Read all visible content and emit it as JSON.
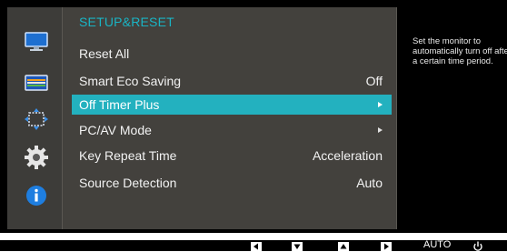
{
  "menu": {
    "title": "SETUP&RESET",
    "items": [
      {
        "label": "Reset All",
        "value": "",
        "arrow": false,
        "selected": false
      },
      {
        "label": "Smart Eco Saving",
        "value": "Off",
        "arrow": false,
        "selected": false
      },
      {
        "label": "Off Timer Plus",
        "value": "",
        "arrow": true,
        "selected": true
      },
      {
        "label": "PC/AV Mode",
        "value": "",
        "arrow": true,
        "selected": false
      },
      {
        "label": "Key Repeat Time",
        "value": "Acceleration",
        "arrow": false,
        "selected": false
      },
      {
        "label": "Source Detection",
        "value": "Auto",
        "arrow": false,
        "selected": false
      }
    ]
  },
  "help": {
    "text": "Set the monitor to automatically turn off after a certain time period."
  },
  "sidebar": {
    "icons": [
      "picture-icon",
      "color-icon",
      "size-position-icon",
      "setup-reset-gear-icon",
      "information-icon"
    ]
  },
  "bottom_bar": {
    "auto_label": "AUTO",
    "buttons": [
      "left-arrow-icon",
      "down-arrow-icon",
      "up-arrow-icon",
      "right-arrow-icon",
      "power-icon"
    ]
  },
  "colors": {
    "accent": "#23b1bf",
    "title": "#1ab4c4",
    "panel": "#43413d",
    "frame": "#000000"
  }
}
